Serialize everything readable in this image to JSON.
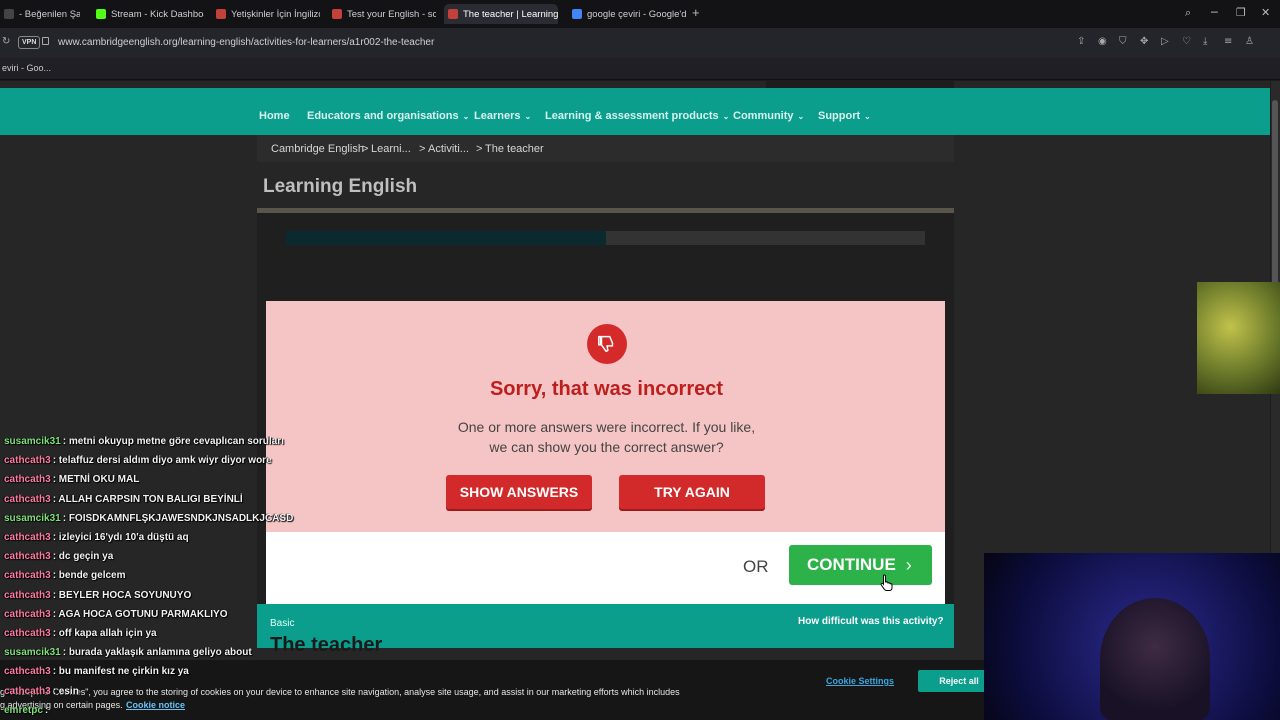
{
  "browser": {
    "tabs": [
      {
        "label": "- Beğenilen Şarkıl",
        "fav": "#444"
      },
      {
        "label": "Stream - Kick Dashboard",
        "fav": "#53fc18"
      },
      {
        "label": "Yetişkinler İçin İngilizce Te",
        "fav": "#c2423b"
      },
      {
        "label": "Test your English - sonuç",
        "fav": "#c2423b"
      },
      {
        "label": "The teacher | Learning En",
        "fav": "#c2423b"
      },
      {
        "label": "google çeviri - Google'da",
        "fav": "#4285f4"
      }
    ],
    "new_tab": "+",
    "vpn": "VPN",
    "url": "www.cambridgeenglish.org/learning-english/activities-for-learners/a1r002-the-teacher",
    "bookmark": "eviri - Goo..."
  },
  "nav": {
    "items": [
      {
        "label": "Home",
        "chevron": false
      },
      {
        "label": "Educators and organisations",
        "chevron": true
      },
      {
        "label": "Learners",
        "chevron": true
      },
      {
        "label": "Learning & assessment products",
        "chevron": true
      },
      {
        "label": "Community",
        "chevron": true
      },
      {
        "label": "Support",
        "chevron": true
      }
    ]
  },
  "breadcrumb": [
    "Cambridge English",
    "Learni...",
    "Activiti...",
    "The teacher"
  ],
  "page_title": "Learning English",
  "progress_fraction": 0.5,
  "feedback": {
    "heading": "Sorry, that was incorrect",
    "message_line1": "One or more answers were incorrect. If you like,",
    "message_line2": "we can show you the correct answer?",
    "show_answers": "SHOW ANSWERS",
    "try_again": "TRY AGAIN",
    "or": "OR",
    "continue": "CONTINUE"
  },
  "activity": {
    "level": "Basic",
    "difficulty_question": "How difficult was this activity?",
    "name": "The teacher"
  },
  "cookie": {
    "text_line1": "g \"Accept All Cookies\", you agree to the storing of cookies on your device to enhance site navigation, analyse site usage, and assist in our marketing efforts which includes",
    "text_line2": "g advertising on certain pages.",
    "notice_link": "Cookie notice",
    "settings": "Cookie Settings",
    "reject": "Reject all"
  },
  "chat": [
    {
      "user": "susamcik31",
      "color": "#7ee07a",
      "msg": ": metni okuyup metne göre cevaplıcan soruları"
    },
    {
      "user": "cathcath3",
      "color": "#ff7aa2",
      "msg": ": telaffuz dersi aldım diyo amk wiyr diyor wore"
    },
    {
      "user": "cathcath3",
      "color": "#ff7aa2",
      "msg": ": METNİ OKU MAL"
    },
    {
      "user": "cathcath3",
      "color": "#ff7aa2",
      "msg": ": ALLAH CARPSIN TON BALIGI BEYİNLİ"
    },
    {
      "user": "susamcik31",
      "color": "#7ee07a",
      "msg": ": FOISDKAMNFLŞKJAWESNDKJNSADLKJCASD"
    },
    {
      "user": "cathcath3",
      "color": "#ff7aa2",
      "msg": ": izleyici 16'ydı 10'a düştü aq"
    },
    {
      "user": "cathcath3",
      "color": "#ff7aa2",
      "msg": ": dc geçin ya"
    },
    {
      "user": "cathcath3",
      "color": "#ff7aa2",
      "msg": ": bende gelcem"
    },
    {
      "user": "cathcath3",
      "color": "#ff7aa2",
      "msg": ": BEYLER HOCA SOYUNUYO"
    },
    {
      "user": "cathcath3",
      "color": "#ff7aa2",
      "msg": ": AGA HOCA GOTUNU PARMAKLIYO"
    },
    {
      "user": "cathcath3",
      "color": "#ff7aa2",
      "msg": ": off kapa allah için ya"
    },
    {
      "user": "susamcik31",
      "color": "#7ee07a",
      "msg": ": burada yaklaşık anlamına geliyo about"
    },
    {
      "user": "cathcath3",
      "color": "#ff7aa2",
      "msg": ": bu manifest ne çirkin kız ya"
    },
    {
      "user": "cathcath3",
      "color": "#ff7aa2",
      "msg": ": esin"
    },
    {
      "user": "emretpc",
      "color": "#7ee07a",
      "msg": ":"
    }
  ]
}
